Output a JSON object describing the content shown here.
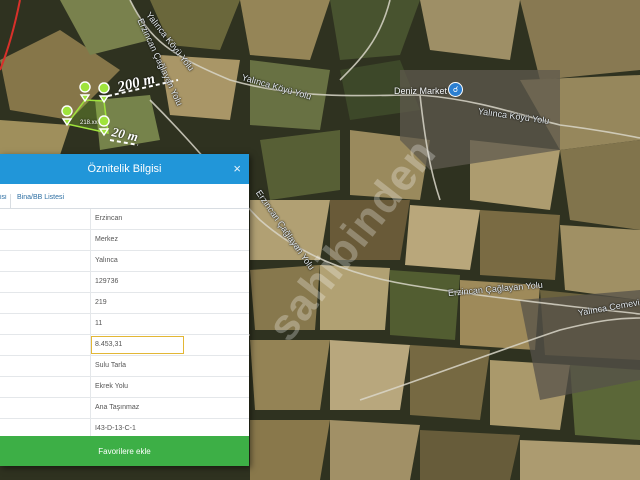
{
  "panel": {
    "title": "Öznitelik Bilgisi",
    "close_icon": "×",
    "tabs": [
      "isi",
      "Bina/BB Listesi"
    ],
    "rows": [
      {
        "value": "Erzincan"
      },
      {
        "value": "Merkez"
      },
      {
        "value": "Yalınca"
      },
      {
        "value": "129736"
      },
      {
        "value": "219"
      },
      {
        "value": "11"
      },
      {
        "value": "8.453,31",
        "active": true
      },
      {
        "value": "Sulu Tarla"
      },
      {
        "value": "Ekrek Yolu"
      },
      {
        "value": "Ana Taşınmaz"
      },
      {
        "value": "I43-D-13-C-1"
      }
    ],
    "favorite_button": "Favorilere ekle"
  },
  "map": {
    "road_labels": {
      "yalinca_koyu_yolu_1": "Yalınca Köyü Yolu",
      "yalinca_koyu_yolu_2": "Yalınca Köyü Yolu",
      "yalinca_koyu_yolu_3": "Yalınca Köyü Yolu",
      "erzincan_caglayan_1": "Erzincan Çağlayan Yolu",
      "erzincan_caglayan_2": "Erzincan Çağlayan Yolu",
      "erzincan_caglayan_3": "Erzincan Çağlayan Yolu",
      "yalinca_cemevi": "Yalınca Cemevi"
    },
    "poi": {
      "label": "Deniz Market",
      "icon": "shopping-cart-icon"
    },
    "measurements": {
      "distance_1": "200 m",
      "distance_2": "20 m",
      "area": "218.xx"
    },
    "watermark": "sahibinden",
    "accent_color": "#2196d9",
    "favorite_color": "#3daf46",
    "parcel_outline_color": "#9fe33c"
  }
}
